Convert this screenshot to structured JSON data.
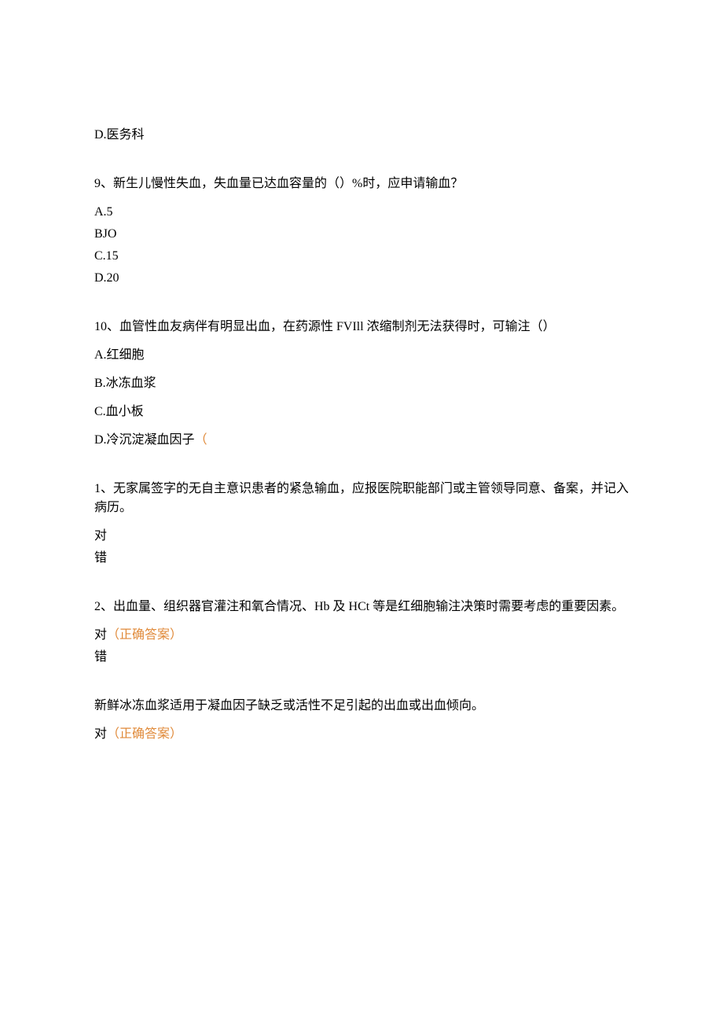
{
  "q8": {
    "option_d": "D.医务科"
  },
  "q9": {
    "text": "9、新生儿慢性失血，失血量已达血容量的（）%时，应申请输血？",
    "option_a": "A.5",
    "option_b": "BJO",
    "option_c": "C.15",
    "option_d": "D.20"
  },
  "q10": {
    "text": "10、血管性血友病伴有明显出血，在药源性 FVIll 浓缩制剂无法获得时，可输注（）",
    "option_a": "A.红细胞",
    "option_b": "B.冰冻血浆",
    "option_c": "C.血小板",
    "option_d_prefix": "D.冷沉淀凝血因子",
    "option_d_mark": "（"
  },
  "tf1": {
    "text": "1、无家属签字的无自主意识患者的紧急输血，应报医院职能部门或主管领导同意、备案，并记入病历。",
    "true": "对",
    "false": "错"
  },
  "tf2": {
    "text": "2、出血量、组织器官灌注和氧合情况、Hb 及 HCt 等是红细胞输注决策时需要考虑的重要因素。",
    "true": "对",
    "false": "错",
    "correct": "（正确答案）"
  },
  "tf3": {
    "text": "新鲜冰冻血浆适用于凝血因子缺乏或活性不足引起的出血或出血倾向。",
    "true": "对",
    "correct": "（正确答案）"
  }
}
